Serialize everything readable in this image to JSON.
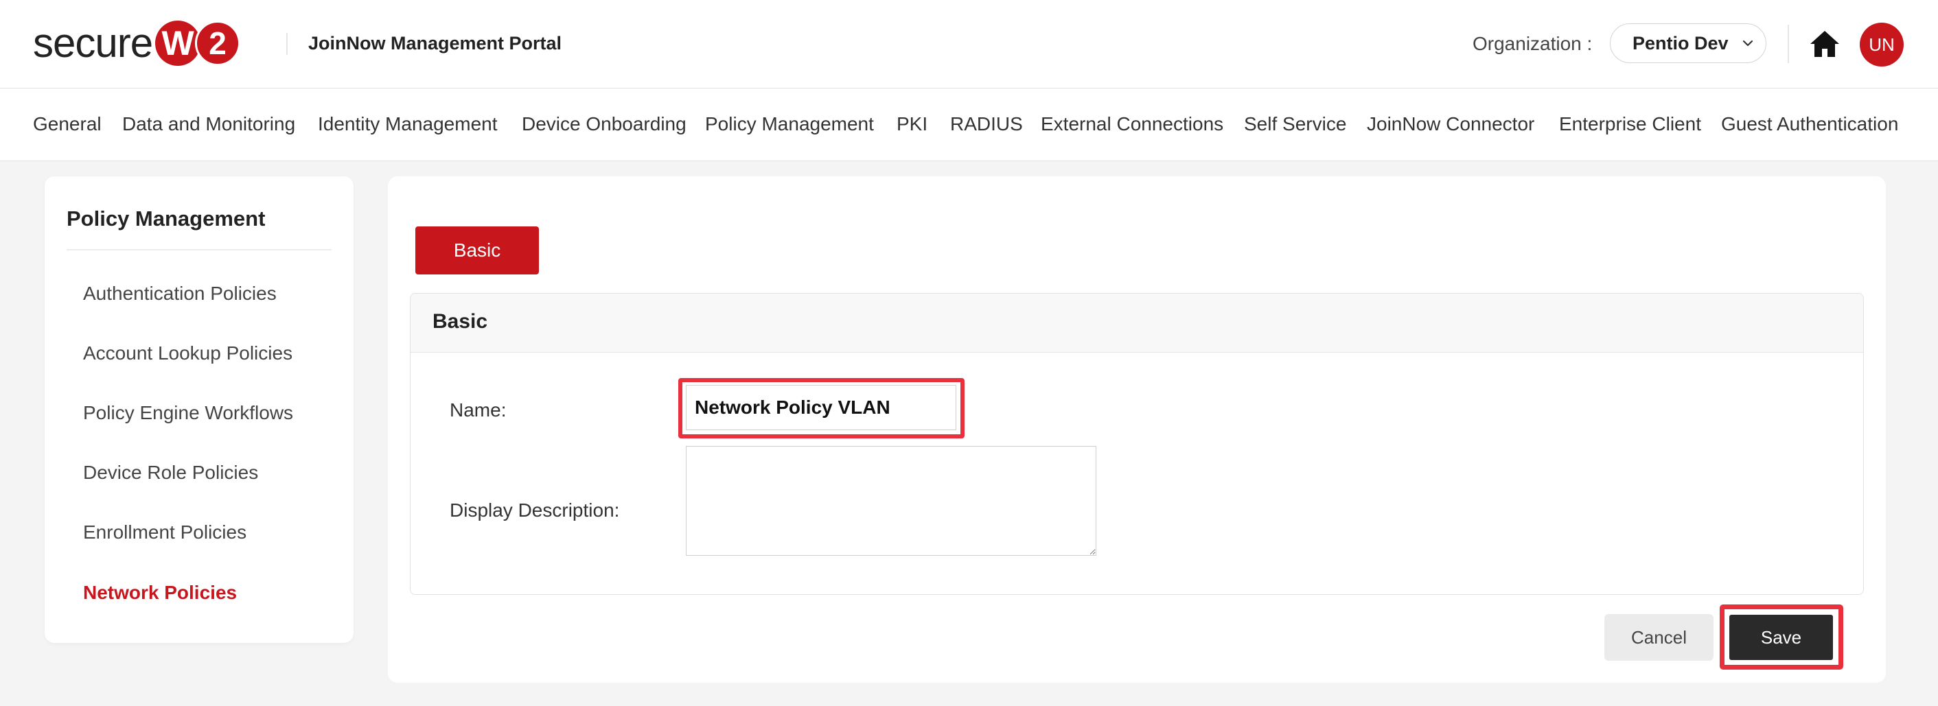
{
  "header": {
    "logo_text": "secure",
    "logo_badge_letter": "W",
    "logo_badge_number": "2",
    "portal_title": "JoinNow Management Portal",
    "org_label": "Organization :",
    "org_value": "Pentio Dev",
    "avatar_initials": "UN",
    "brand_color": "#c8161d"
  },
  "nav": {
    "items": [
      "General",
      "Data and Monitoring",
      "Identity Management",
      "Device Onboarding",
      "Policy Management",
      "PKI",
      "RADIUS",
      "External Connections",
      "Self Service",
      "JoinNow Connector",
      "Enterprise Client",
      "Guest Authentication"
    ]
  },
  "sidebar": {
    "title": "Policy Management",
    "items": [
      "Authentication Policies",
      "Account Lookup Policies",
      "Policy Engine Workflows",
      "Device Role Policies",
      "Enrollment Policies",
      "Network Policies"
    ],
    "active_item": "Network Policies"
  },
  "main": {
    "tab_label": "Basic",
    "card_title": "Basic",
    "name_label": "Name:",
    "name_value": "Network Policy VLAN",
    "description_label": "Display Description:",
    "description_value": "",
    "cancel_label": "Cancel",
    "save_label": "Save",
    "highlight_color": "#e8313c"
  }
}
